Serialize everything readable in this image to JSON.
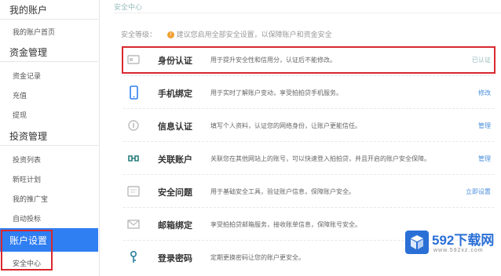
{
  "sidebar": {
    "sections": [
      {
        "title": "我的账户",
        "items": [
          "我的账户首页"
        ]
      },
      {
        "title": "资金管理",
        "items": [
          "资金记录",
          "充值",
          "提现"
        ]
      },
      {
        "title": "投资管理",
        "items": [
          "投资列表",
          "新旺计划",
          "我的推广宝",
          "自动投标"
        ]
      },
      {
        "title": "账户设置",
        "items": [
          "安全中心"
        ]
      }
    ]
  },
  "main": {
    "breadcrumb": "安全中心",
    "security_level_label": "安全等级：",
    "security_tip": "建议您启用全部安全设置，以保障账户和资金安全",
    "rows": [
      {
        "icon": "id-card-icon",
        "label": "身份认证",
        "desc": "用于提升安全性和信用分，认证后不能修改。",
        "action": "已认证"
      },
      {
        "icon": "mobile-phone-icon",
        "label": "手机绑定",
        "desc": "用于实时了解账户变动，享受拍拍贷手机服务。",
        "action": "修改"
      },
      {
        "icon": "info-auth-icon",
        "label": "信息认证",
        "desc": "填写个人资料，认证您的网络身份，让账户更能信任。",
        "action": "管理"
      },
      {
        "icon": "link-account-icon",
        "label": "关联账户",
        "desc": "关联您在其他网站上的账号，可以快速登入拍拍贷，并且开启的账户安全保障。",
        "action": "管理"
      },
      {
        "icon": "security-question-icon",
        "label": "安全问题",
        "desc": "用于基础安全工具，验证账户信息，保障账户安全。",
        "action": "立即设置"
      },
      {
        "icon": "mail-icon",
        "label": "邮箱绑定",
        "desc": "享受拍拍贷邮箱服务，接收账单信息，保障账号安全。",
        "action": ""
      },
      {
        "icon": "key-icon",
        "label": "登录密码",
        "desc": "定期更换密码让您的账户更安全。",
        "action": ""
      }
    ]
  },
  "watermark": {
    "brand": "592下载网",
    "url": "www.592xz.com"
  },
  "colors": {
    "accent": "#2f7ef2",
    "highlight_border": "#d9282f",
    "link": "#4a8fdd"
  }
}
